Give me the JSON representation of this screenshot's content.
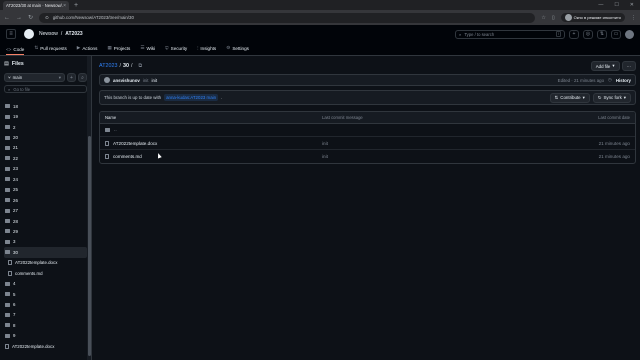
{
  "browser": {
    "tab_title": "AT2023/30 at main · Newsow/...",
    "tab_close": "×",
    "new_tab": "+",
    "url": "github.com/Newsow/AT2023/tree/main/30",
    "profile_label": "Окно в режиме инкогнито"
  },
  "header": {
    "owner": "Newsow",
    "separator": "/",
    "repo": "AT2023",
    "search_placeholder": "Type / to search",
    "search_key": "/"
  },
  "repo_nav": [
    {
      "label": "Code",
      "icon": "code-icon",
      "glyph": "<>"
    },
    {
      "label": "Pull requests",
      "icon": "pull-request-icon",
      "glyph": "⇅"
    },
    {
      "label": "Actions",
      "icon": "actions-icon",
      "glyph": "▶"
    },
    {
      "label": "Projects",
      "icon": "projects-icon",
      "glyph": "▦"
    },
    {
      "label": "Wiki",
      "icon": "wiki-icon",
      "glyph": "☰"
    },
    {
      "label": "Security",
      "icon": "shield-icon",
      "glyph": "⛨"
    },
    {
      "label": "Insights",
      "icon": "graph-icon",
      "glyph": "⫶"
    },
    {
      "label": "Settings",
      "icon": "gear-icon",
      "glyph": "⚙"
    }
  ],
  "sidebar": {
    "title": "Files",
    "branch": "main",
    "goto_placeholder": "Go to file",
    "tree": [
      {
        "label": "18",
        "type": "folder"
      },
      {
        "label": "19",
        "type": "folder"
      },
      {
        "label": "2",
        "type": "folder"
      },
      {
        "label": "20",
        "type": "folder"
      },
      {
        "label": "21",
        "type": "folder"
      },
      {
        "label": "22",
        "type": "folder"
      },
      {
        "label": "23",
        "type": "folder"
      },
      {
        "label": "24",
        "type": "folder"
      },
      {
        "label": "25",
        "type": "folder"
      },
      {
        "label": "26",
        "type": "folder"
      },
      {
        "label": "27",
        "type": "folder"
      },
      {
        "label": "28",
        "type": "folder"
      },
      {
        "label": "29",
        "type": "folder"
      },
      {
        "label": "3",
        "type": "folder"
      },
      {
        "label": "30",
        "type": "folder",
        "selected": true
      },
      {
        "label": "AT2022template.docx",
        "type": "file",
        "child": true
      },
      {
        "label": "comments.md",
        "type": "file",
        "child": true
      },
      {
        "label": "4",
        "type": "folder"
      },
      {
        "label": "5",
        "type": "folder"
      },
      {
        "label": "6",
        "type": "folder"
      },
      {
        "label": "7",
        "type": "folder"
      },
      {
        "label": "8",
        "type": "folder"
      },
      {
        "label": "9",
        "type": "folder"
      },
      {
        "label": "AT2022template.docx",
        "type": "file"
      }
    ]
  },
  "main": {
    "path_repo": "AT2023",
    "path_sep": "/",
    "path_current": "30",
    "path_trailing": "/",
    "add_file": "Add file",
    "more": "···",
    "commit": {
      "author": "ansvishunov",
      "message": "init",
      "hash": "init",
      "time": "Edited · 21 minutes ago",
      "history": "History"
    },
    "status_text": "This branch is up to date with",
    "status_branch": "anna-kudas:AT2023 main",
    "status_end": ".",
    "contribute": "Contribute",
    "sync_fork": "Sync fork",
    "table_headers": {
      "name": "Name",
      "message": "Last commit message",
      "date": "Last commit date"
    },
    "updir": "..",
    "rows": [
      {
        "name": "AT2022template.docx",
        "message": "init",
        "date": "21 minutes ago"
      },
      {
        "name": "comments.md",
        "message": "init",
        "date": "21 minutes ago"
      }
    ]
  }
}
